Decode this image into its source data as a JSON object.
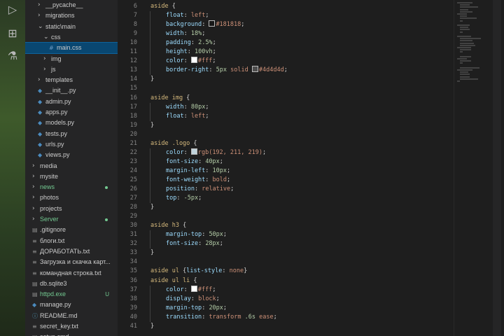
{
  "activity_icons": [
    "debug-icon",
    "extensions-icon",
    "test-beaker-icon"
  ],
  "explorer": {
    "items": [
      {
        "label": "__pycache__",
        "kind": "folder",
        "collapsed": true,
        "depth": 2
      },
      {
        "label": "migrations",
        "kind": "folder",
        "collapsed": true,
        "depth": 2
      },
      {
        "label": "static\\main",
        "kind": "folder",
        "collapsed": false,
        "depth": 2
      },
      {
        "label": "css",
        "kind": "folder",
        "collapsed": false,
        "depth": 3
      },
      {
        "label": "main.css",
        "kind": "css-file",
        "depth": 4,
        "selected": true
      },
      {
        "label": "img",
        "kind": "folder",
        "collapsed": true,
        "depth": 3
      },
      {
        "label": "js",
        "kind": "folder",
        "collapsed": true,
        "depth": 3
      },
      {
        "label": "templates",
        "kind": "folder",
        "collapsed": true,
        "depth": 2
      },
      {
        "label": "__init__.py",
        "kind": "py-file",
        "depth": 2
      },
      {
        "label": "admin.py",
        "kind": "py-file",
        "depth": 2
      },
      {
        "label": "apps.py",
        "kind": "py-file",
        "depth": 2
      },
      {
        "label": "models.py",
        "kind": "py-file",
        "depth": 2
      },
      {
        "label": "tests.py",
        "kind": "py-file",
        "depth": 2
      },
      {
        "label": "urls.py",
        "kind": "py-file",
        "depth": 2
      },
      {
        "label": "views.py",
        "kind": "py-file",
        "depth": 2
      },
      {
        "label": "media",
        "kind": "folder",
        "collapsed": true,
        "depth": 1
      },
      {
        "label": "mysite",
        "kind": "folder",
        "collapsed": true,
        "depth": 1
      },
      {
        "label": "news",
        "kind": "folder",
        "collapsed": true,
        "depth": 1,
        "color": "#73c991",
        "dot": true
      },
      {
        "label": "photos",
        "kind": "folder",
        "collapsed": true,
        "depth": 1
      },
      {
        "label": "projects",
        "kind": "folder",
        "collapsed": true,
        "depth": 1
      },
      {
        "label": "Server",
        "kind": "folder",
        "collapsed": true,
        "depth": 1,
        "color": "#73c991",
        "dot": true
      },
      {
        "label": ".gitignore",
        "kind": "file",
        "depth": 1
      },
      {
        "label": "блоги.txt",
        "kind": "txt-file",
        "depth": 1
      },
      {
        "label": "ДОРАБОТАТЬ.txt",
        "kind": "txt-file",
        "depth": 1
      },
      {
        "label": "Загрузка и скачка карт...",
        "kind": "txt-file",
        "depth": 1
      },
      {
        "label": "командная строка.txt",
        "kind": "txt-file",
        "depth": 1
      },
      {
        "label": "db.sqlite3",
        "kind": "file",
        "depth": 1
      },
      {
        "label": "httpd.exe",
        "kind": "file",
        "depth": 1,
        "color": "#73c991",
        "badge": "U"
      },
      {
        "label": "manage.py",
        "kind": "py-file",
        "depth": 1
      },
      {
        "label": "README.md",
        "kind": "md-file",
        "depth": 1
      },
      {
        "label": "secret_key.txt",
        "kind": "txt-file",
        "depth": 1
      },
      {
        "label": "setup.cmd",
        "kind": "file",
        "depth": 1
      }
    ]
  },
  "editor": {
    "lines": [
      {
        "n": "6",
        "tokens": [
          [
            "sel",
            "aside"
          ],
          [
            "punc",
            " {"
          ]
        ]
      },
      {
        "n": "7",
        "indent": 1,
        "tokens": [
          [
            "prop",
            "float"
          ],
          [
            "punc",
            ": "
          ],
          [
            "val",
            "left"
          ],
          [
            "punc",
            ";"
          ]
        ]
      },
      {
        "n": "8",
        "indent": 1,
        "tokens": [
          [
            "prop",
            "background"
          ],
          [
            "punc",
            ": "
          ],
          [
            "swatch",
            "#181818"
          ],
          [
            "val",
            "#181818"
          ],
          [
            "punc",
            ";"
          ]
        ]
      },
      {
        "n": "9",
        "indent": 1,
        "tokens": [
          [
            "prop",
            "width"
          ],
          [
            "punc",
            ": "
          ],
          [
            "num",
            "18%"
          ],
          [
            "punc",
            ";"
          ]
        ]
      },
      {
        "n": "10",
        "indent": 1,
        "tokens": [
          [
            "prop",
            "padding"
          ],
          [
            "punc",
            ": "
          ],
          [
            "num",
            "2.5%"
          ],
          [
            "punc",
            ";"
          ]
        ]
      },
      {
        "n": "11",
        "indent": 1,
        "tokens": [
          [
            "prop",
            "height"
          ],
          [
            "punc",
            ": "
          ],
          [
            "num",
            "100vh"
          ],
          [
            "punc",
            ";"
          ]
        ]
      },
      {
        "n": "12",
        "indent": 1,
        "tokens": [
          [
            "prop",
            "color"
          ],
          [
            "punc",
            ": "
          ],
          [
            "swatch",
            "#ffffff"
          ],
          [
            "val",
            "#fff"
          ],
          [
            "punc",
            ";"
          ]
        ]
      },
      {
        "n": "13",
        "indent": 1,
        "tokens": [
          [
            "prop",
            "border-right"
          ],
          [
            "punc",
            ": "
          ],
          [
            "num",
            "5px"
          ],
          [
            "val",
            " solid "
          ],
          [
            "swatch",
            "#4d4d4d"
          ],
          [
            "val",
            "#4d4d4d"
          ],
          [
            "punc",
            ";"
          ]
        ]
      },
      {
        "n": "14",
        "tokens": [
          [
            "punc",
            "}"
          ]
        ]
      },
      {
        "n": "15",
        "tokens": []
      },
      {
        "n": "16",
        "tokens": [
          [
            "sel",
            "aside img"
          ],
          [
            "punc",
            " {"
          ]
        ]
      },
      {
        "n": "17",
        "indent": 1,
        "tokens": [
          [
            "prop",
            "width"
          ],
          [
            "punc",
            ": "
          ],
          [
            "num",
            "80px"
          ],
          [
            "punc",
            ";"
          ]
        ]
      },
      {
        "n": "18",
        "indent": 1,
        "tokens": [
          [
            "prop",
            "float"
          ],
          [
            "punc",
            ": "
          ],
          [
            "val",
            "left"
          ],
          [
            "punc",
            ";"
          ]
        ]
      },
      {
        "n": "19",
        "tokens": [
          [
            "punc",
            "}"
          ]
        ]
      },
      {
        "n": "20",
        "tokens": []
      },
      {
        "n": "21",
        "tokens": [
          [
            "sel",
            "aside .logo"
          ],
          [
            "punc",
            " {"
          ]
        ]
      },
      {
        "n": "22",
        "indent": 1,
        "tokens": [
          [
            "prop",
            "color"
          ],
          [
            "punc",
            ": "
          ],
          [
            "swatch",
            "#c0d3db"
          ],
          [
            "val",
            "rgb(192, 211, 219)"
          ],
          [
            "punc",
            ";"
          ]
        ]
      },
      {
        "n": "23",
        "indent": 1,
        "tokens": [
          [
            "prop",
            "font-size"
          ],
          [
            "punc",
            ": "
          ],
          [
            "num",
            "40px"
          ],
          [
            "punc",
            ";"
          ]
        ]
      },
      {
        "n": "24",
        "indent": 1,
        "tokens": [
          [
            "prop",
            "margin-left"
          ],
          [
            "punc",
            ": "
          ],
          [
            "num",
            "10px"
          ],
          [
            "punc",
            ";"
          ]
        ]
      },
      {
        "n": "25",
        "indent": 1,
        "tokens": [
          [
            "prop",
            "font-weight"
          ],
          [
            "punc",
            ": "
          ],
          [
            "val",
            "bold"
          ],
          [
            "punc",
            ";"
          ]
        ]
      },
      {
        "n": "26",
        "indent": 1,
        "tokens": [
          [
            "prop",
            "position"
          ],
          [
            "punc",
            ": "
          ],
          [
            "val",
            "relative"
          ],
          [
            "punc",
            ";"
          ]
        ]
      },
      {
        "n": "27",
        "indent": 1,
        "tokens": [
          [
            "prop",
            "top"
          ],
          [
            "punc",
            ": "
          ],
          [
            "num",
            "-5px"
          ],
          [
            "punc",
            ";"
          ]
        ]
      },
      {
        "n": "28",
        "tokens": [
          [
            "punc",
            "}"
          ]
        ]
      },
      {
        "n": "29",
        "tokens": []
      },
      {
        "n": "30",
        "tokens": [
          [
            "sel",
            "aside h3"
          ],
          [
            "punc",
            " {"
          ]
        ]
      },
      {
        "n": "31",
        "indent": 1,
        "tokens": [
          [
            "prop",
            "margin-top"
          ],
          [
            "punc",
            ": "
          ],
          [
            "num",
            "50px"
          ],
          [
            "punc",
            ";"
          ]
        ]
      },
      {
        "n": "32",
        "indent": 1,
        "tokens": [
          [
            "prop",
            "font-size"
          ],
          [
            "punc",
            ": "
          ],
          [
            "num",
            "28px"
          ],
          [
            "punc",
            ";"
          ]
        ]
      },
      {
        "n": "33",
        "tokens": [
          [
            "punc",
            "}"
          ]
        ]
      },
      {
        "n": "34",
        "tokens": []
      },
      {
        "n": "35",
        "tokens": [
          [
            "sel",
            "aside ul"
          ],
          [
            "punc",
            " {"
          ],
          [
            "prop",
            "list-style"
          ],
          [
            "punc",
            ": "
          ],
          [
            "val",
            "none"
          ],
          [
            "punc",
            "}"
          ]
        ]
      },
      {
        "n": "36",
        "tokens": [
          [
            "sel",
            "aside ul li"
          ],
          [
            "punc",
            " {"
          ]
        ]
      },
      {
        "n": "37",
        "indent": 1,
        "tokens": [
          [
            "prop",
            "color"
          ],
          [
            "punc",
            ": "
          ],
          [
            "swatch",
            "#ffffff"
          ],
          [
            "val",
            "#fff"
          ],
          [
            "punc",
            ";"
          ]
        ]
      },
      {
        "n": "38",
        "indent": 1,
        "tokens": [
          [
            "prop",
            "display"
          ],
          [
            "punc",
            ": "
          ],
          [
            "val",
            "block"
          ],
          [
            "punc",
            ";"
          ]
        ]
      },
      {
        "n": "39",
        "indent": 1,
        "tokens": [
          [
            "prop",
            "margin-top"
          ],
          [
            "punc",
            ": "
          ],
          [
            "num",
            "20px"
          ],
          [
            "punc",
            ";"
          ]
        ]
      },
      {
        "n": "40",
        "indent": 1,
        "tokens": [
          [
            "prop",
            "transition"
          ],
          [
            "punc",
            ": "
          ],
          [
            "val",
            "transform "
          ],
          [
            "num",
            ".6s"
          ],
          [
            "val",
            " ease"
          ],
          [
            "punc",
            ";"
          ]
        ]
      },
      {
        "n": "41",
        "tokens": [
          [
            "punc",
            "}"
          ]
        ]
      }
    ]
  }
}
